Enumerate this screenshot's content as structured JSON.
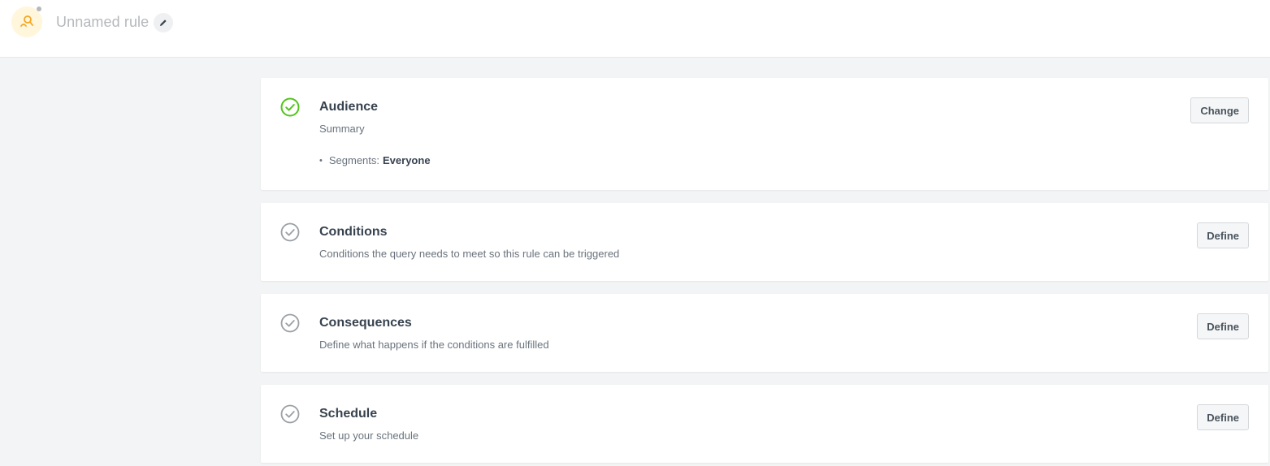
{
  "header": {
    "rule_name": "Unnamed rule",
    "icon": "rule-icon",
    "edit_icon": "pencil-icon",
    "brand_color": "#f5a623"
  },
  "sections": [
    {
      "title": "Audience",
      "description": "Summary",
      "status": "complete",
      "action_label": "Change",
      "summary": {
        "label": "Segments:",
        "value": "Everyone"
      }
    },
    {
      "title": "Conditions",
      "description": "Conditions the query needs to meet so this rule can be triggered",
      "status": "incomplete",
      "action_label": "Define"
    },
    {
      "title": "Consequences",
      "description": "Define what happens if the conditions are fulfilled",
      "status": "incomplete",
      "action_label": "Define"
    },
    {
      "title": "Schedule",
      "description": "Set up your schedule",
      "status": "incomplete",
      "action_label": "Define"
    }
  ],
  "colors": {
    "complete": "#52c41a",
    "incomplete": "#9aa0a6"
  }
}
